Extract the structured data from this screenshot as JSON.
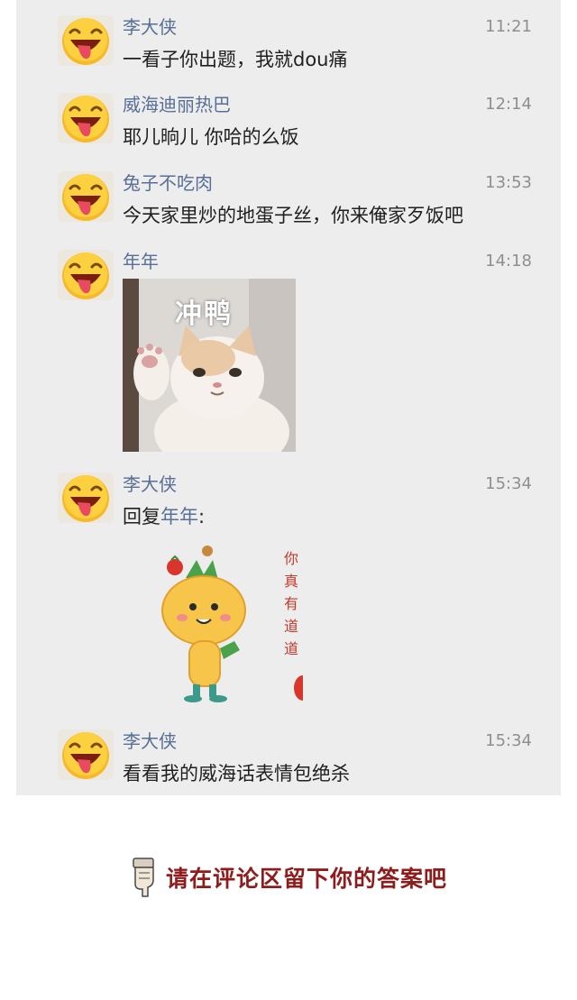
{
  "messages": [
    {
      "name": "李大侠",
      "time": "11:21",
      "text": "一看子你出题，我就dou痛"
    },
    {
      "name": "威海迪丽热巴",
      "time": "12:14",
      "text": "耶儿晌儿 你哈的么饭"
    },
    {
      "name": "兔子不吃肉",
      "time": "13:53",
      "text": "今天家里炒的地蛋子丝，你来俺家歹饭吧"
    },
    {
      "name": "年年",
      "time": "14:18",
      "image_caption": "冲鸭"
    },
    {
      "name": "李大侠",
      "time": "15:34",
      "reply_prefix": "回复",
      "reply_to": "年年",
      "reply_suffix": ":",
      "sticker_text": [
        "你",
        "真",
        "有",
        "道",
        "道"
      ]
    },
    {
      "name": "李大侠",
      "time": "15:34",
      "text": "看看我的威海话表情包绝杀"
    }
  ],
  "footer": {
    "text": "请在评论区留下你的答案吧",
    "icon": "pointing-hand-icon"
  },
  "colors": {
    "name": "#586f97",
    "footer": "#8f1c1c",
    "panel": "#ededed"
  }
}
